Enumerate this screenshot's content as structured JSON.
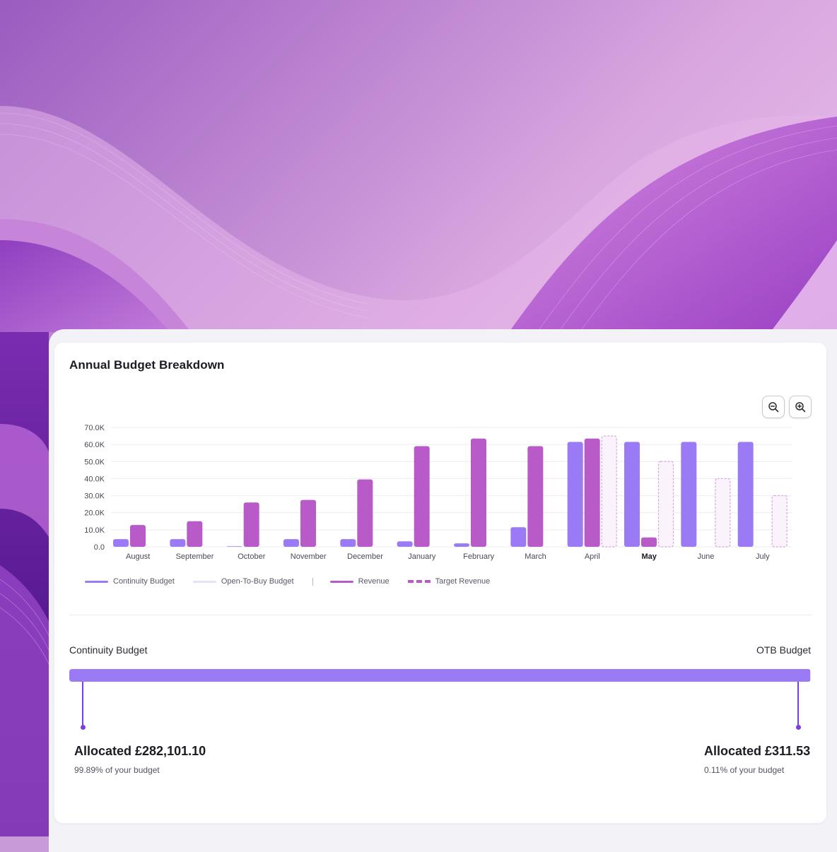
{
  "card": {
    "title": "Annual Budget Breakdown"
  },
  "zoom": {
    "out_icon": "zoom-out-icon",
    "in_icon": "zoom-in-icon"
  },
  "colors": {
    "continuity": "#9b7bf5",
    "open_to_buy": "#e6e1f7",
    "revenue": "#b95ac9",
    "target_revenue": "#d9a2e4",
    "pointer": "#7b3fe0"
  },
  "chart_data": {
    "type": "bar",
    "categories": [
      "August",
      "September",
      "October",
      "November",
      "December",
      "January",
      "February",
      "March",
      "April",
      "May",
      "June",
      "July"
    ],
    "highlighted_category": "May",
    "y_ticks": [
      "0.0",
      "10.0K",
      "20.0K",
      "30.0K",
      "40.0K",
      "50.0K",
      "60.0K",
      "70.0K"
    ],
    "ylim": [
      0,
      70000
    ],
    "grid": true,
    "legend_position": "bottom-left",
    "series": [
      {
        "name": "Continuity Budget",
        "style": "solid",
        "values": [
          4500,
          4500,
          300,
          4500,
          4500,
          3200,
          2000,
          11500,
          61500,
          61500,
          61500,
          61500
        ]
      },
      {
        "name": "Open-To-Buy Budget",
        "style": "light",
        "values": [
          0,
          0,
          0,
          0,
          0,
          0,
          0,
          0,
          0,
          0,
          0,
          0
        ]
      },
      {
        "name": "Revenue",
        "style": "solid",
        "values": [
          12800,
          15000,
          26000,
          27500,
          39500,
          59000,
          63500,
          59000,
          63500,
          5500,
          null,
          null
        ]
      },
      {
        "name": "Target Revenue",
        "style": "dashed",
        "values": [
          null,
          null,
          null,
          null,
          null,
          null,
          null,
          null,
          65000,
          50000,
          40000,
          30000
        ]
      }
    ]
  },
  "legend": {
    "continuity": "Continuity Budget",
    "open_to_buy": "Open-To-Buy Budget",
    "revenue": "Revenue",
    "target_revenue": "Target Revenue"
  },
  "budget": {
    "left_label": "Continuity Budget",
    "right_label": "OTB Budget",
    "continuity_percent": 99.89,
    "continuity_allocated": "Allocated £282,101.10",
    "continuity_share": "99.89% of your budget",
    "otb_allocated": "Allocated £311.53",
    "otb_share": "0.11% of your budget"
  }
}
